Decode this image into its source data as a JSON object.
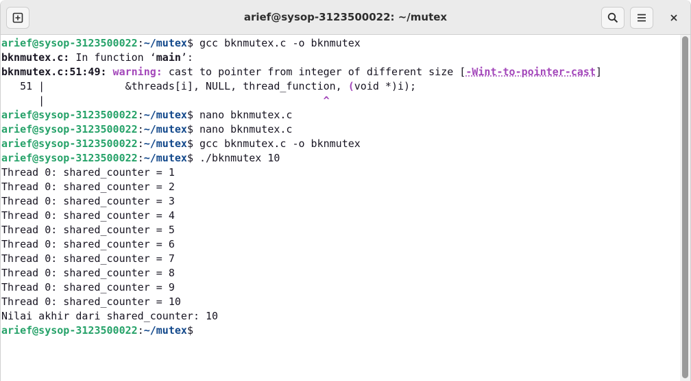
{
  "window": {
    "title": "arief@sysop-3123500022: ~/mutex",
    "icons": {
      "new_tab": "new-tab-icon",
      "search": "search-icon",
      "menu": "hamburger-menu-icon",
      "close": "close-icon"
    }
  },
  "prompt": {
    "user_host": "arief@sysop-3123500022",
    "sep": ":",
    "path": "~/mutex",
    "symbol": "$"
  },
  "cmd1": " gcc bknmutex.c -o bknmutex",
  "err": {
    "file_label": "bknmutex.c:",
    "in_function": " In function ‘",
    "func_name": "main",
    "func_close": "’:",
    "location": "bknmutex.c:51:49:",
    "warning_label": " warning:",
    "warning_msg": " cast to pointer from integer of different size [",
    "warning_flag": "-Wint-to-pointer-cast",
    "warning_close": "]",
    "code_prefix": "   51 |             &threads[i], NULL, thread_function, ",
    "code_hl": "(",
    "code_suffix": "void *)i);",
    "marker_prefix": "      |                                             ",
    "marker": "^"
  },
  "cmd2": " nano bknmutex.c",
  "cmd3": " nano bknmutex.c",
  "cmd4": " gcc bknmutex.c -o bknmutex",
  "cmd5": " ./bknmutex 10",
  "output": [
    "Thread 0: shared_counter = 1",
    "Thread 0: shared_counter = 2",
    "Thread 0: shared_counter = 3",
    "Thread 0: shared_counter = 4",
    "Thread 0: shared_counter = 5",
    "Thread 0: shared_counter = 6",
    "Thread 0: shared_counter = 7",
    "Thread 0: shared_counter = 8",
    "Thread 0: shared_counter = 9",
    "Thread 0: shared_counter = 10"
  ],
  "final_line": "Nilai akhir dari shared_counter: 10"
}
